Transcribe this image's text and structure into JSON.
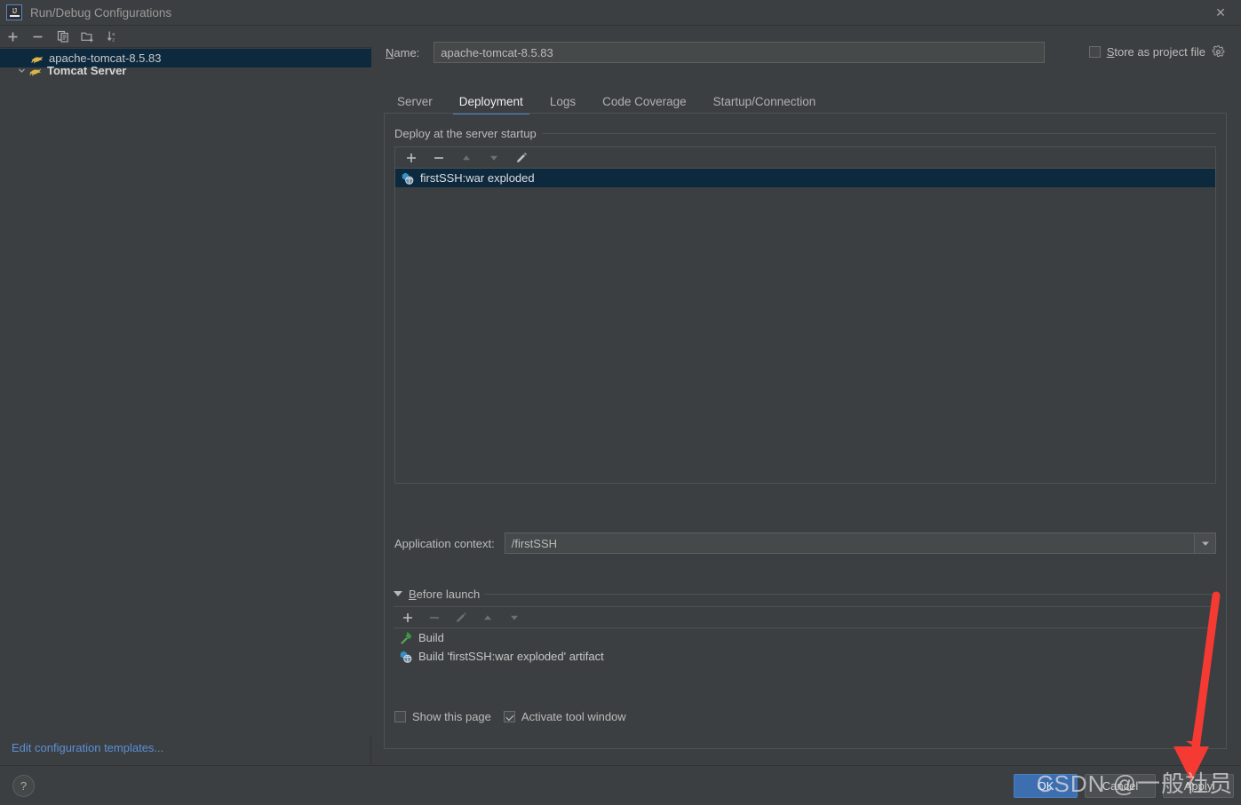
{
  "window": {
    "title": "Run/Debug Configurations",
    "app_icon": "intellij-idea-icon",
    "close_label": "✕"
  },
  "sidebar": {
    "toolbar": [
      {
        "name": "add-configuration-button",
        "glyph": "+"
      },
      {
        "name": "remove-configuration-button",
        "glyph": "−"
      },
      {
        "name": "copy-configuration-button",
        "glyph": "copy-icon"
      },
      {
        "name": "new-folder-button",
        "glyph": "folder-add-icon"
      },
      {
        "name": "sort-configurations-button",
        "glyph": "sort-az-icon"
      }
    ],
    "tree": [
      {
        "label": "Tomcat Server",
        "type": "group",
        "expanded": true,
        "selected": false,
        "icon": "tomcat-icon"
      },
      {
        "label": "apache-tomcat-8.5.83",
        "type": "child",
        "expanded": false,
        "selected": true,
        "icon": "tomcat-icon"
      }
    ],
    "edit_templates_link": "Edit configuration templates..."
  },
  "main": {
    "name_label_prefix": "N",
    "name_label_rest": "ame:",
    "name_value": "apache-tomcat-8.5.83",
    "name_placeholder": "",
    "store_as_project_file": {
      "label_prefix": "S",
      "label_rest": "tore as project file",
      "checked": false,
      "gear_icon": "gear-icon"
    },
    "tabs": [
      {
        "label": "Server",
        "active": false
      },
      {
        "label": "Deployment",
        "active": true
      },
      {
        "label": "Logs",
        "active": false
      },
      {
        "label": "Code Coverage",
        "active": false
      },
      {
        "label": "Startup/Connection",
        "active": false
      }
    ],
    "deploy_group": {
      "title": "Deploy at the server startup",
      "toolbar": [
        {
          "name": "add-artifact-button",
          "glyph": "+",
          "enabled": true
        },
        {
          "name": "remove-artifact-button",
          "glyph": "−",
          "enabled": true
        },
        {
          "name": "move-up-button",
          "glyph": "▲",
          "enabled": false
        },
        {
          "name": "move-down-button",
          "glyph": "▼",
          "enabled": false
        },
        {
          "name": "edit-artifact-button",
          "glyph": "pencil-icon",
          "enabled": true
        }
      ],
      "items": [
        {
          "label": "firstSSH:war exploded",
          "icon": "artifact-icon",
          "selected": true
        }
      ]
    },
    "application_context": {
      "label": "Application context:",
      "value": "/firstSSH",
      "placeholder": ""
    },
    "before_launch": {
      "label_prefix": "B",
      "label_rest": "efore launch",
      "expanded": true,
      "toolbar": [
        {
          "name": "add-before-launch-task-button",
          "glyph": "+",
          "enabled": true
        },
        {
          "name": "remove-before-launch-task-button",
          "glyph": "−",
          "enabled": false
        },
        {
          "name": "edit-before-launch-task-button",
          "glyph": "pencil-icon",
          "enabled": false
        },
        {
          "name": "move-task-up-button",
          "glyph": "▲",
          "enabled": false
        },
        {
          "name": "move-task-down-button",
          "glyph": "▼",
          "enabled": false
        }
      ],
      "tasks": [
        {
          "label": "Build",
          "icon": "build-hammer-icon"
        },
        {
          "label": "Build 'firstSSH:war exploded' artifact",
          "icon": "artifact-icon"
        }
      ]
    },
    "options": [
      {
        "name": "show-this-page-checkbox",
        "label": "Show this page",
        "checked": false
      },
      {
        "name": "activate-tool-window-checkbox",
        "label": "Activate tool window",
        "checked": true
      }
    ]
  },
  "footer": {
    "help_glyph": "?",
    "buttons": [
      {
        "name": "ok-button",
        "label": "OK",
        "primary": true
      },
      {
        "name": "cancel-button",
        "label": "Cancel",
        "primary": false
      },
      {
        "name": "apply-button",
        "label": "Apply",
        "primary": false
      }
    ]
  },
  "annotations": {
    "watermark_text": "CSDN @一般社员",
    "arrow_color": "#f43a32"
  },
  "colors": {
    "background": "#3c3f41",
    "selection": "#0d293e",
    "accent": "#4a88c7",
    "link": "#5c8fd6",
    "primary_button": "#3c6eb0",
    "text": "#bbbbbb"
  }
}
